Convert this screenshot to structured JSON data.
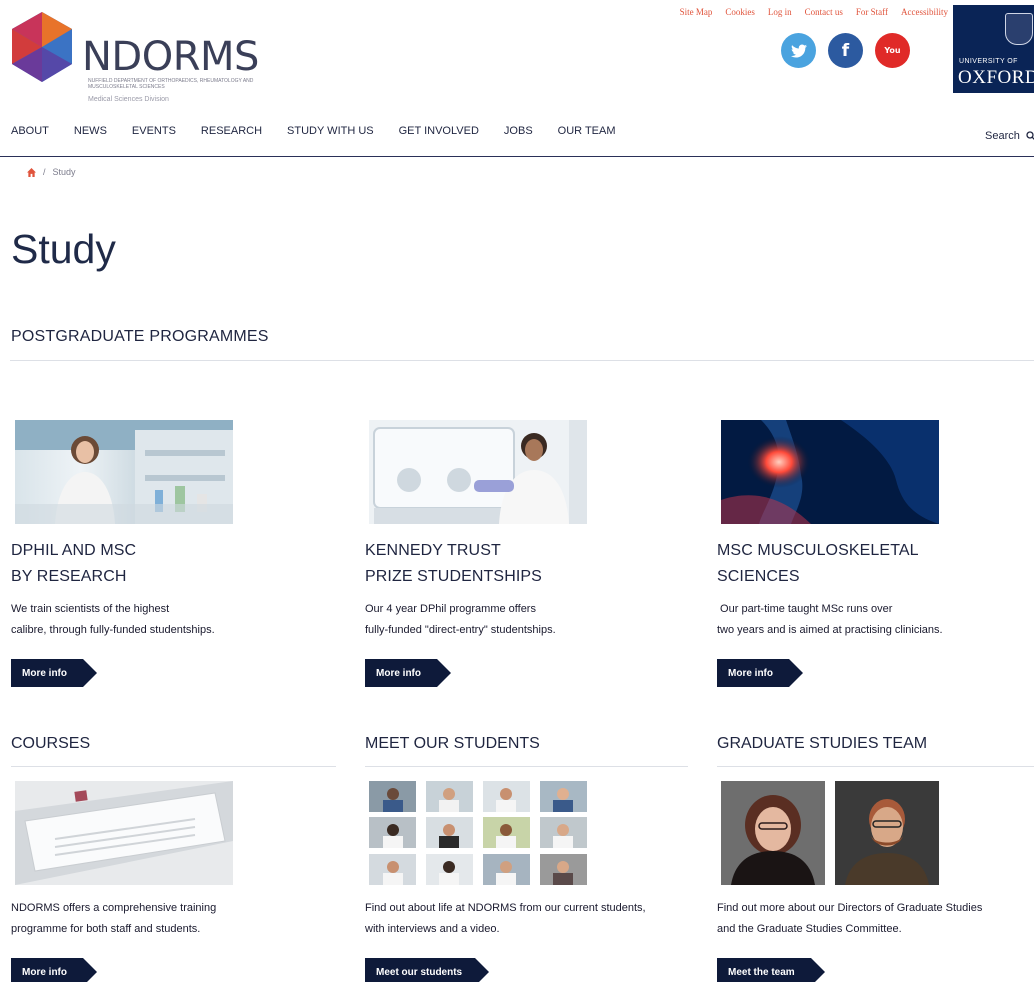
{
  "brand": {
    "name": "NDORMS",
    "subtitle": "Nuffield Department of Orthopaedics, Rheumatology and Musculoskeletal Sciences",
    "division": "Medical Sciences Division"
  },
  "top_links": [
    "Site Map",
    "Cookies",
    "Log in",
    "Contact us",
    "For Staff",
    "Accessibility"
  ],
  "social": {
    "twitter": "t",
    "facebook": "f",
    "youtube": "You"
  },
  "oxford": {
    "line1": "UNIVERSITY OF",
    "line2": "OXFORD"
  },
  "nav": [
    "ABOUT",
    "NEWS",
    "EVENTS",
    "RESEARCH",
    "STUDY WITH US",
    "GET INVOLVED",
    "JOBS",
    "OUR TEAM"
  ],
  "search_label": "Search",
  "breadcrumb": {
    "home_icon": "home-icon",
    "separator": "/",
    "current": "Study"
  },
  "page_title": "Study",
  "section_title": "POSTGRADUATE PROGRAMMES",
  "cards": [
    {
      "title1": "DPHIL AND MSC",
      "title2": "BY RESEARCH",
      "desc1": "We train scientists of the highest",
      "desc2": "calibre, through fully-funded studentships.",
      "button": "More info"
    },
    {
      "title1": "KENNEDY TRUST",
      "title2": "PRIZE STUDENTSHIPS",
      "desc1": "Our 4 year DPhil programme offers",
      "desc2": "fully-funded \"direct-entry\" studentships.",
      "button": "More info"
    },
    {
      "title1": "MSC MUSCULOSKELETAL",
      "title2": "SCIENCES",
      "desc1": " Our part-time taught MSc runs over",
      "desc2": "two years and is aimed at practising clinicians.",
      "button": "More info"
    }
  ],
  "bottom": [
    {
      "title": "COURSES",
      "desc1": "NDORMS offers a comprehensive training",
      "desc2": "programme for both staff and students.",
      "button": "More info"
    },
    {
      "title": "MEET OUR STUDENTS",
      "desc1": "Find out about life at NDORMS from our current students,",
      "desc2": "with interviews and a video.",
      "button": "Meet our students"
    },
    {
      "title": "GRADUATE STUDIES TEAM",
      "desc1": "Find out more about our Directors of Graduate Studies",
      "desc2": "and the Graduate Studies Committee.",
      "button": "Meet the team"
    }
  ],
  "colors": {
    "accent": "#e0543c",
    "navy": "#0e1a3a",
    "oxford": "#0a2456"
  }
}
